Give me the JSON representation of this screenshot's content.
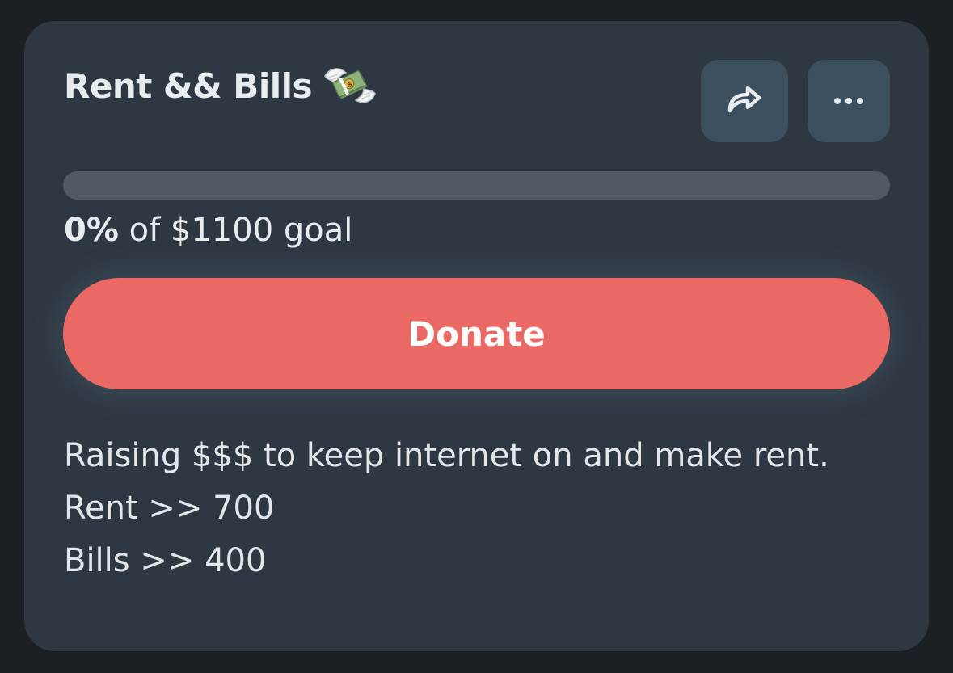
{
  "card": {
    "title": "Rent && Bills",
    "title_emoji_icon": "money-with-wings-icon",
    "share_icon": "share-arrow-icon",
    "more_icon": "more-dots-icon",
    "progress": {
      "percent_label": "0%",
      "goal_text": "of $1100 goal",
      "fraction": 0
    },
    "donate_label": "Donate",
    "description": [
      "Raising $$$ to keep internet on and make rent.",
      "Rent >> 700",
      "Bills >> 400"
    ]
  },
  "colors": {
    "background": "#1b2025",
    "card": "#2e3843",
    "icon_button": "#3c4f5f",
    "progress_track": "#515a63",
    "accent": "#eb6964",
    "text": "#e8ecef"
  }
}
